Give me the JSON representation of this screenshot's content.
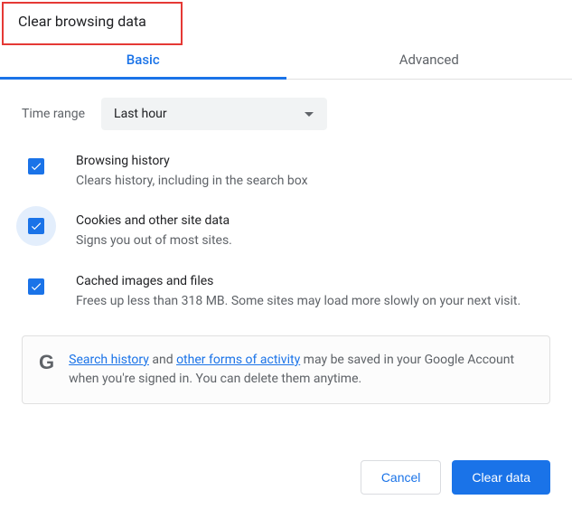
{
  "dialog": {
    "title": "Clear browsing data"
  },
  "tabs": {
    "basic": "Basic",
    "advanced": "Advanced"
  },
  "time": {
    "label": "Time range",
    "value": "Last hour"
  },
  "options": {
    "history": {
      "title": "Browsing history",
      "desc": "Clears history, including in the search box"
    },
    "cookies": {
      "title": "Cookies and other site data",
      "desc": "Signs you out of most sites."
    },
    "cache": {
      "title": "Cached images and files",
      "desc": "Frees up less than 318 MB. Some sites may load more slowly on your next visit."
    }
  },
  "notice": {
    "link1": "Search history",
    "mid1": " and ",
    "link2": "other forms of activity",
    "rest": " may be saved in your Google Account when you're signed in. You can delete them anytime."
  },
  "buttons": {
    "cancel": "Cancel",
    "clear": "Clear data"
  }
}
